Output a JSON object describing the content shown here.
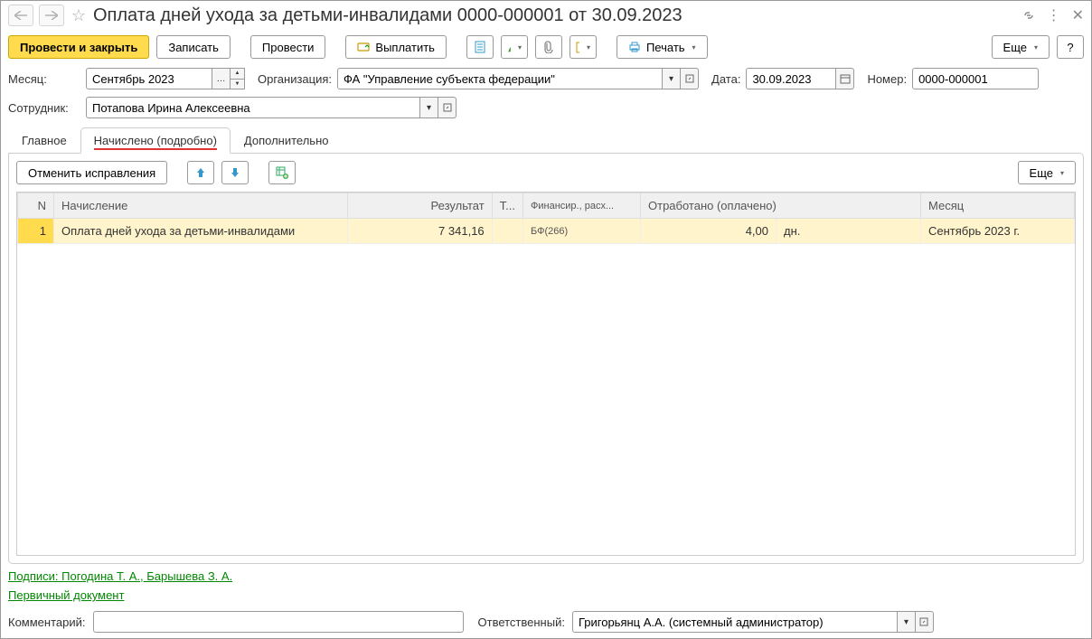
{
  "title": "Оплата дней ухода за детьми-инвалидами 0000-000001 от 30.09.2023",
  "toolbar": {
    "post_close": "Провести и закрыть",
    "save": "Записать",
    "post": "Провести",
    "pay": "Выплатить",
    "print": "Печать",
    "more": "Еще",
    "help": "?"
  },
  "form": {
    "month_label": "Месяц:",
    "month": "Сентябрь 2023",
    "org_label": "Организация:",
    "org": "ФА \"Управление субъекта федерации\"",
    "date_label": "Дата:",
    "date": "30.09.2023",
    "number_label": "Номер:",
    "number": "0000-000001",
    "employee_label": "Сотрудник:",
    "employee": "Потапова Ирина Алексеевна"
  },
  "tabs": {
    "main": "Главное",
    "detailed": "Начислено (подробно)",
    "extra": "Дополнительно"
  },
  "panel": {
    "cancel_corr": "Отменить исправления",
    "more": "Еще"
  },
  "table": {
    "headers": {
      "n": "N",
      "accrual": "Начисление",
      "result": "Результат",
      "t": "Т...",
      "fin": "Финансир., расх...",
      "worked": "Отработано (оплачено)",
      "month": "Месяц"
    },
    "rows": [
      {
        "n": "1",
        "accrual": "Оплата дней ухода за детьми-инвалидами",
        "result": "7 341,16",
        "t": "",
        "fin": "БФ(266)",
        "worked": "4,00",
        "unit": "дн.",
        "month": "Сентябрь 2023 г."
      }
    ]
  },
  "footer": {
    "signatures": "Подписи: Погодина Т. А., Барышева З. А.",
    "primary_doc": "Первичный документ",
    "comment_label": "Комментарий:",
    "comment": "",
    "resp_label": "Ответственный:",
    "resp": "Григорьянц А.А. (системный администратор)"
  }
}
